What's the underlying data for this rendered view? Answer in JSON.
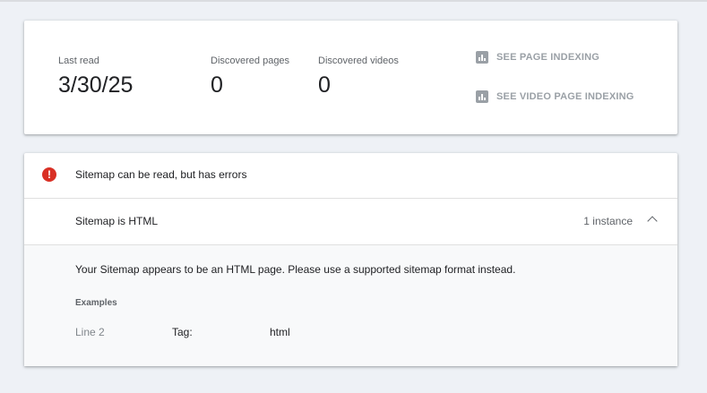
{
  "summary": {
    "last_read_label": "Last read",
    "last_read_value": "3/30/25",
    "discovered_pages_label": "Discovered pages",
    "discovered_pages_value": "0",
    "discovered_videos_label": "Discovered videos",
    "discovered_videos_value": "0",
    "see_page_indexing": "SEE PAGE INDEXING",
    "see_video_page_indexing": "SEE VIDEO PAGE INDEXING"
  },
  "details": {
    "status_icon": "error-icon",
    "status_icon_glyph": "!",
    "status_text": "Sitemap can be read, but has errors",
    "issue_title": "Sitemap is HTML",
    "issue_count": "1 instance",
    "issue_description": "Your Sitemap appears to be an HTML page. Please use a supported sitemap format instead.",
    "examples_label": "Examples",
    "examples": [
      {
        "line": "Line 2",
        "tag_label": "Tag:",
        "tag_value": "html"
      }
    ]
  },
  "colors": {
    "background": "#eef1f6",
    "error": "#d93025",
    "muted": "#9aa0a6"
  }
}
